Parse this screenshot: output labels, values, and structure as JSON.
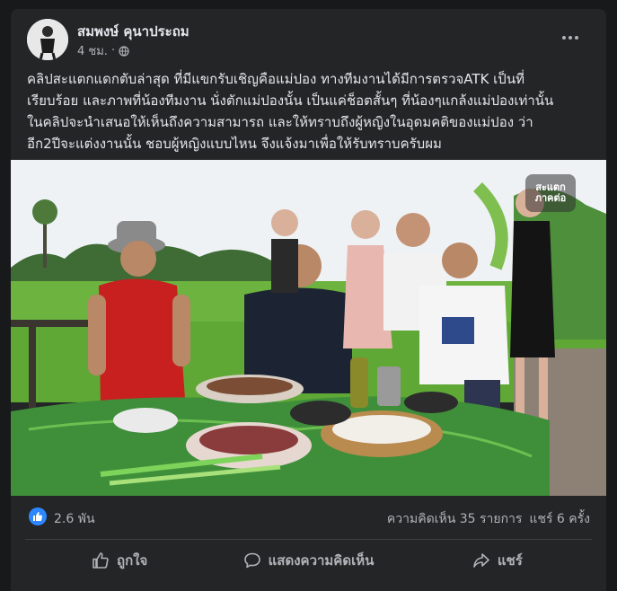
{
  "post": {
    "author": "สมพงษ์ คุนาประถม",
    "time": "4 ชม.",
    "audience_icon": "globe-icon",
    "more_icon": "more-dots-icon",
    "text": "คลิปสะแตกแดกตับล่าสุด ที่มีแขกรับเชิญคือแม่ปอง ทางทีมงานได้มีการตรวจATK เป็นที่\nเรียบร้อย และภาพที่น้องทีมงาน นั่งตักแม่ปองนั้น เป็นแค่ช็อตสั้นๆ ที่น้องๆแกล้งแม่ปองเท่านั้น\nในคลิปจะนำเสนอให้เห็นถึงความสามารถ และให้ทราบถึงผู้หญิงในอุดมคติของแม่ปอง ว่า\nอีก2ปีจะแต่งงานนั้น ชอบผู้หญิงแบบไหน จึงแจ้งมาเพื่อให้รับทราบครับผม",
    "photo_logo": "สะแตก ภาคต่อ"
  },
  "stats": {
    "reaction_icon": "thumbs-up-icon",
    "likes": "2.6 พัน",
    "comments": "ความคิดเห็น 35 รายการ",
    "shares": "แชร์ 6 ครั้ง"
  },
  "actions": {
    "like": "ถูกใจ",
    "comment": "แสดงความคิดเห็น",
    "share": "แชร์"
  },
  "colors": {
    "background": "#18191a",
    "card": "#242526",
    "text_primary": "#e4e6eb",
    "text_secondary": "#b0b3b8",
    "accent_blue": "#2d88ff"
  }
}
